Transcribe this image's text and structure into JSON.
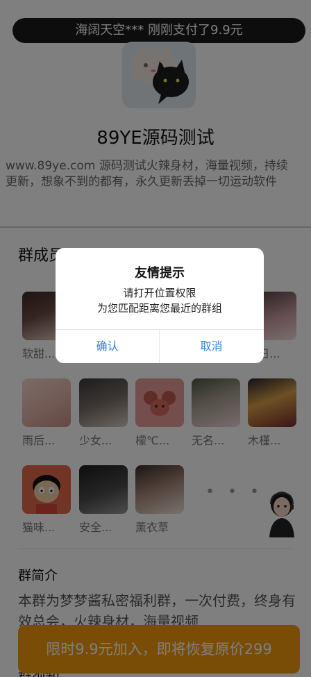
{
  "banner": {
    "text": "海阔天空*** 刚刚支付了9.9元"
  },
  "group": {
    "title": "89YE源码测试",
    "desc_line1": "www.89ye.com 源码测试火辣身材，海量视频，持续",
    "desc_line2": "更新，想象不到的都有，永久更新丢掉一切运动软件"
  },
  "members": {
    "title": "群成员",
    "items": [
      {
        "name": "软甜..."
      },
      {
        "name": "..."
      },
      {
        "name": "..."
      },
      {
        "name": "..."
      },
      {
        "name": "...日..."
      },
      {
        "name": "雨后..."
      },
      {
        "name": "少女..."
      },
      {
        "name": "檬℃..."
      },
      {
        "name": "无名..."
      },
      {
        "name": "木槿..."
      },
      {
        "name": "猫味..."
      },
      {
        "name": "安全..."
      },
      {
        "name": "薰衣草"
      }
    ],
    "more": "• • •"
  },
  "intro": {
    "title": "群简介",
    "text": "本群为梦梦酱私密福利群，一次付费，终身有效总会，火辣身材，海量视频"
  },
  "section_next": {
    "title": "群须知"
  },
  "cta": {
    "label": "限时9.9元加入，即将恢复原价299",
    "color": "#f29a0c"
  },
  "dialog": {
    "title": "友情提示",
    "line1": "请打开位置权限",
    "line2": "为您匹配距离您最近的群组",
    "confirm": "确认",
    "cancel": "取消",
    "button_color": "#2f7fd6"
  }
}
